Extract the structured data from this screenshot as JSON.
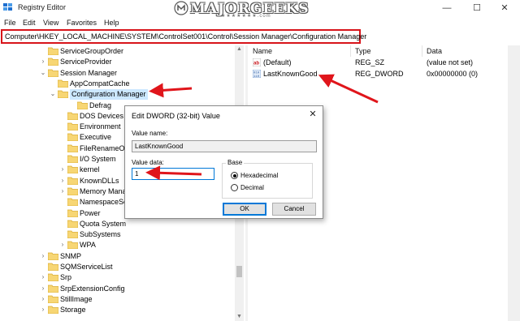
{
  "window": {
    "title": "Registry Editor",
    "minimize_glyph": "—",
    "maximize_glyph": "☐",
    "close_glyph": "✕"
  },
  "watermark": {
    "text": "MAJORGEEKS",
    "stars": "★★★★★★★.com"
  },
  "menu": [
    "File",
    "Edit",
    "View",
    "Favorites",
    "Help"
  ],
  "address": "Computer\\HKEY_LOCAL_MACHINE\\SYSTEM\\ControlSet001\\Control\\Session Manager\\Configuration Manager",
  "tree": [
    {
      "label": "ServiceGroupOrder",
      "expander": ""
    },
    {
      "label": "ServiceProvider",
      "expander": ">"
    },
    {
      "label": "Session Manager",
      "expander": "v"
    },
    {
      "label": "AppCompatCache",
      "expander": ""
    },
    {
      "label": "Configuration Manager",
      "expander": "v",
      "selected": true
    },
    {
      "label": "Defrag",
      "expander": ""
    },
    {
      "label": "DOS Devices",
      "expander": ""
    },
    {
      "label": "Environment",
      "expander": ""
    },
    {
      "label": "Executive",
      "expander": ""
    },
    {
      "label": "FileRenameOperat",
      "expander": ""
    },
    {
      "label": "I/O System",
      "expander": ""
    },
    {
      "label": "kernel",
      "expander": ">"
    },
    {
      "label": "KnownDLLs",
      "expander": ">"
    },
    {
      "label": "Memory Managem",
      "expander": ">"
    },
    {
      "label": "NamespaceSeparat",
      "expander": ""
    },
    {
      "label": "Power",
      "expander": ""
    },
    {
      "label": "Quota System",
      "expander": ""
    },
    {
      "label": "SubSystems",
      "expander": ""
    },
    {
      "label": "WPA",
      "expander": ">"
    },
    {
      "label": "SNMP",
      "expander": ">"
    },
    {
      "label": "SQMServiceList",
      "expander": ""
    },
    {
      "label": "Srp",
      "expander": ">"
    },
    {
      "label": "SrpExtensionConfig",
      "expander": ">"
    },
    {
      "label": "StillImage",
      "expander": ">"
    },
    {
      "label": "Storage",
      "expander": ">"
    }
  ],
  "values_pane": {
    "headers": {
      "name": "Name",
      "type": "Type",
      "data": "Data"
    },
    "rows": [
      {
        "name": "(Default)",
        "type": "REG_SZ",
        "data": "(value not set)",
        "icon": "string-value-icon"
      },
      {
        "name": "LastKnownGood",
        "type": "REG_DWORD",
        "data": "0x00000000 (0)",
        "icon": "dword-value-icon"
      }
    ]
  },
  "dialog": {
    "title": "Edit DWORD (32-bit) Value",
    "close_glyph": "✕",
    "value_name_label": "Value name:",
    "value_name": "LastKnownGood",
    "value_data_label": "Value data:",
    "value_data": "1",
    "base_label": "Base",
    "radio_hex": "Hexadecimal",
    "radio_dec": "Decimal",
    "selected_base": "Hexadecimal",
    "ok_label": "OK",
    "cancel_label": "Cancel"
  },
  "annotations": {
    "arrow_color": "#e0151b"
  }
}
